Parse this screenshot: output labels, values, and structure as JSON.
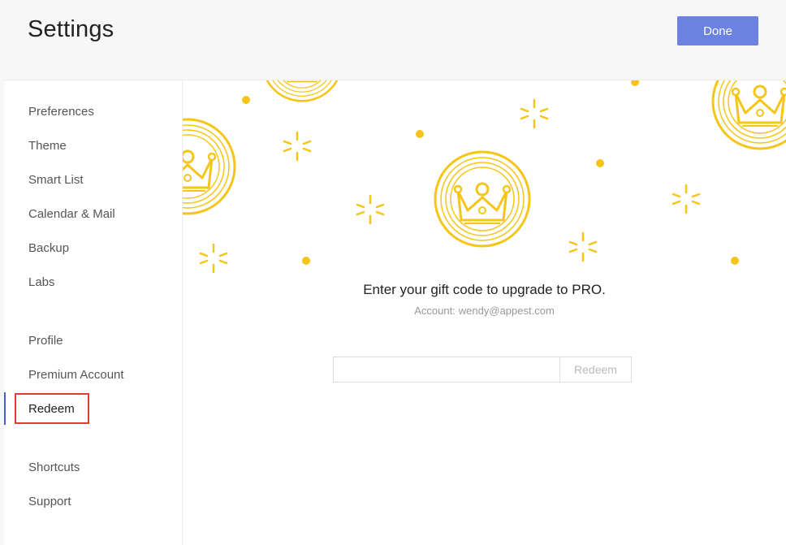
{
  "header": {
    "title": "Settings",
    "done_label": "Done"
  },
  "sidebar": {
    "groups": [
      [
        "Preferences",
        "Theme",
        "Smart List",
        "Calendar & Mail",
        "Backup",
        "Labs"
      ],
      [
        "Profile",
        "Premium Account",
        "Redeem"
      ],
      [
        "Shortcuts",
        "Support"
      ]
    ],
    "items": [
      {
        "label": "Preferences"
      },
      {
        "label": "Theme"
      },
      {
        "label": "Smart List"
      },
      {
        "label": "Calendar & Mail"
      },
      {
        "label": "Backup"
      },
      {
        "label": "Labs"
      },
      {
        "label": "Profile"
      },
      {
        "label": "Premium Account"
      },
      {
        "label": "Redeem",
        "active": true
      },
      {
        "label": "Shortcuts"
      },
      {
        "label": "Support"
      }
    ]
  },
  "redeem": {
    "headline": "Enter your gift code to upgrade to PRO.",
    "account_label": "Account:",
    "account_email": "wendy@appest.com",
    "code_value": "",
    "code_placeholder": "",
    "button_label": "Redeem"
  },
  "colors": {
    "accent": "#6b82e0",
    "active_indicator": "#4a5fc8",
    "highlight": "#e53935",
    "illustration": "#f5c518"
  },
  "icons": [
    "crown-coin-icon",
    "sparkle-icon",
    "dot-icon"
  ]
}
